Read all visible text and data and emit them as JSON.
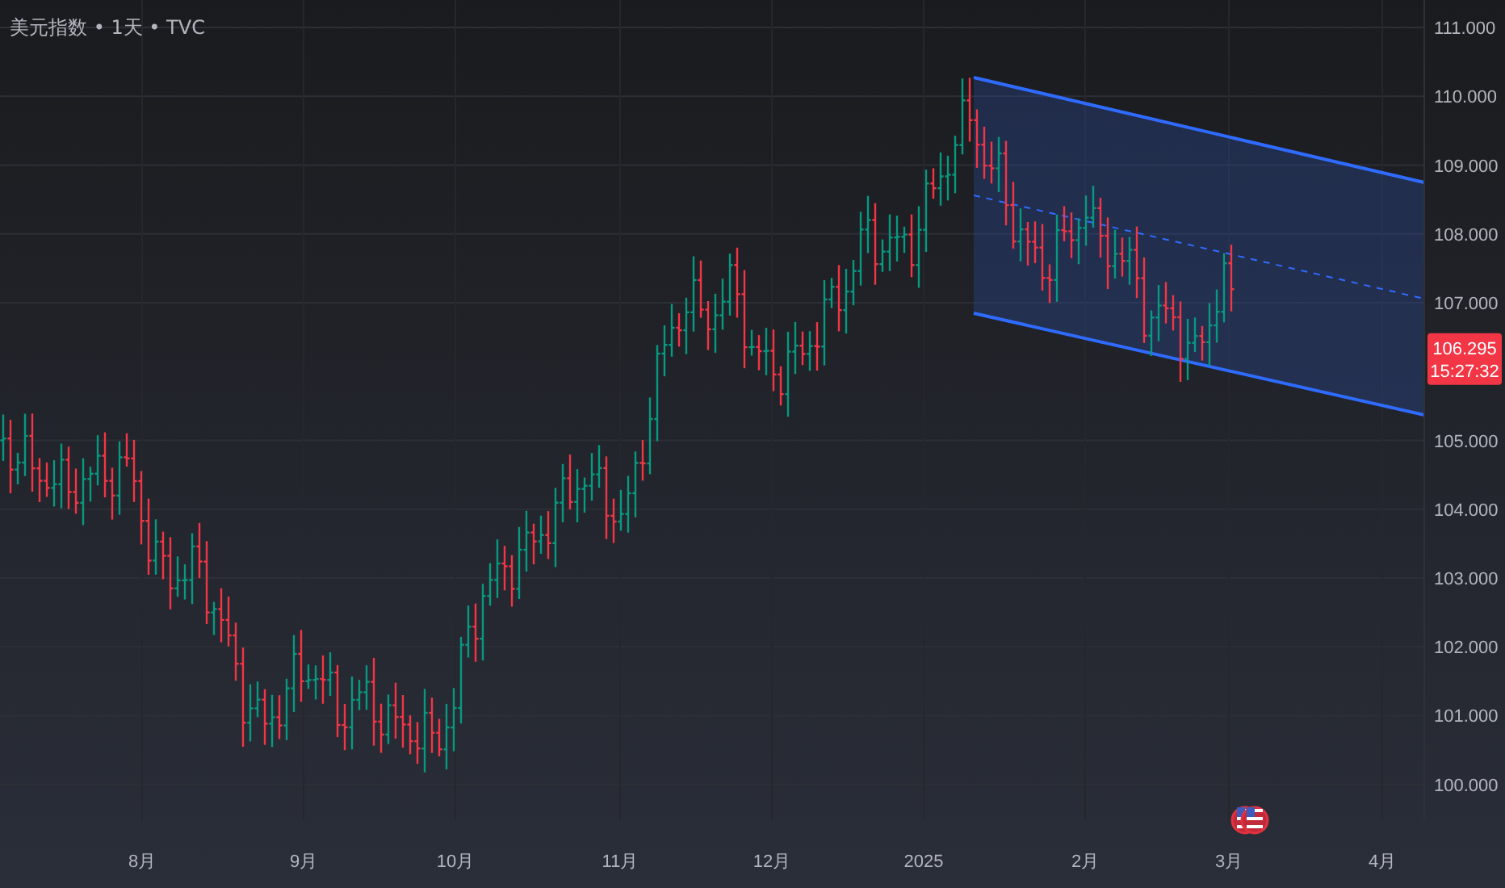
{
  "title": "美元指数 • 1天 • TVC",
  "price_axis": {
    "labels": [
      "111.000",
      "110.000",
      "109.000",
      "108.000",
      "107.000",
      "105.000",
      "104.000",
      "103.000",
      "102.000",
      "101.000",
      "100.000"
    ]
  },
  "time_axis": {
    "labels": [
      "8月",
      "9月",
      "10月",
      "11月",
      "12月",
      "2025",
      "2月",
      "3月",
      "4月"
    ]
  },
  "price_label": {
    "price": "106.295",
    "countdown": "15:27:32"
  }
}
